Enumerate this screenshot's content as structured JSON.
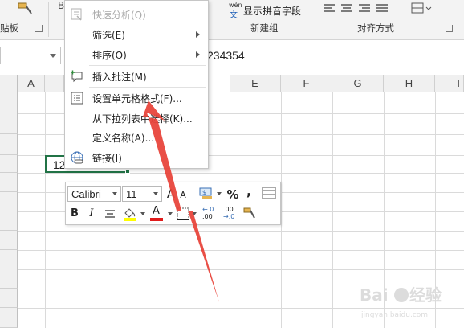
{
  "ribbon": {
    "clipboard_label": "贴板",
    "phonetic_button": "显示拼音字段",
    "phonetic_small": "wén",
    "new_group_label": "新建组",
    "alignment_label": "对齐方式"
  },
  "formula_bar": {
    "value": "234354"
  },
  "columns": [
    "A",
    "E",
    "F",
    "G",
    "H",
    "I"
  ],
  "active_cell": {
    "value": "12"
  },
  "context_menu": {
    "items": [
      {
        "label": "快速分析(Q)",
        "icon": "quick-analysis-icon",
        "disabled": true
      },
      {
        "label": "筛选(E)",
        "submenu": true
      },
      {
        "label": "排序(O)",
        "submenu": true
      },
      {
        "label": "插入批注(M)",
        "icon": "insert-comment-icon"
      },
      {
        "label": "设置单元格格式(F)...",
        "icon": "format-cells-icon"
      },
      {
        "label": "从下拉列表中选择(K)..."
      },
      {
        "label": "定义名称(A)..."
      },
      {
        "label": "链接(I)",
        "icon": "link-icon"
      }
    ]
  },
  "mini_toolbar": {
    "font_name": "Calibri",
    "font_size": "11",
    "grow_font": "A",
    "shrink_font": "A",
    "percent": "%",
    "comma": ",",
    "bold": "B",
    "italic": "I",
    "font_color_letter": "A",
    "increase_decimal_top": "←.0",
    "increase_decimal_bottom": ".00",
    "decrease_decimal_top": ".00",
    "decrease_decimal_bottom": "→.0"
  },
  "colors": {
    "accent_green": "#217346",
    "arrow_red": "#e8463c",
    "highlight_yellow": "#ffff00",
    "font_red": "#e01b1b"
  }
}
